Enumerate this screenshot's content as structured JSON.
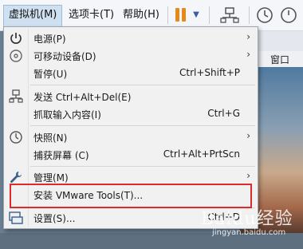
{
  "menubar": {
    "items": [
      {
        "label": "虚拟机(M)",
        "active": true
      },
      {
        "label": "选项卡(T)",
        "active": false
      },
      {
        "label": "帮助(H)",
        "active": false
      }
    ],
    "icons": [
      "pause-icon",
      "dropdown-arrow-icon",
      "network-icon",
      "clock-icon",
      "snapshot-icon"
    ]
  },
  "dropdown": {
    "items": [
      {
        "label": "电源(P)",
        "shortcut": "",
        "submenu": true,
        "icon": "power-icon"
      },
      {
        "label": "可移动设备(D)",
        "shortcut": "",
        "submenu": true,
        "icon": "removable-device-icon"
      },
      {
        "label": "暂停(U)",
        "shortcut": "Ctrl+Shift+P",
        "submenu": false,
        "icon": ""
      },
      {
        "label": "发送 Ctrl+Alt+Del(E)",
        "shortcut": "",
        "submenu": false,
        "icon": "send-keys-icon"
      },
      {
        "label": "抓取输入内容(I)",
        "shortcut": "Ctrl+G",
        "submenu": false,
        "icon": ""
      },
      {
        "label": "快照(N)",
        "shortcut": "",
        "submenu": true,
        "icon": "snapshot-icon"
      },
      {
        "label": "捕获屏幕 (C)",
        "shortcut": "Ctrl+Alt+PrtScn",
        "submenu": false,
        "icon": ""
      },
      {
        "label": "管理(M)",
        "shortcut": "",
        "submenu": true,
        "icon": "wrench-icon"
      },
      {
        "label": "安装 VMware Tools(T)...",
        "shortcut": "",
        "submenu": false,
        "icon": ""
      },
      {
        "label": "设置(S)...",
        "shortcut": "Ctrl+D",
        "submenu": false,
        "icon": "settings-icon"
      }
    ]
  },
  "background": {
    "window_label": "窗口"
  },
  "watermark": {
    "text": "Baidu经验",
    "url": "jingyan.baidu.com"
  },
  "colors": {
    "highlight": "#e0292b",
    "menu_active": "#cfe0f1",
    "pause": "#e38a1a"
  }
}
